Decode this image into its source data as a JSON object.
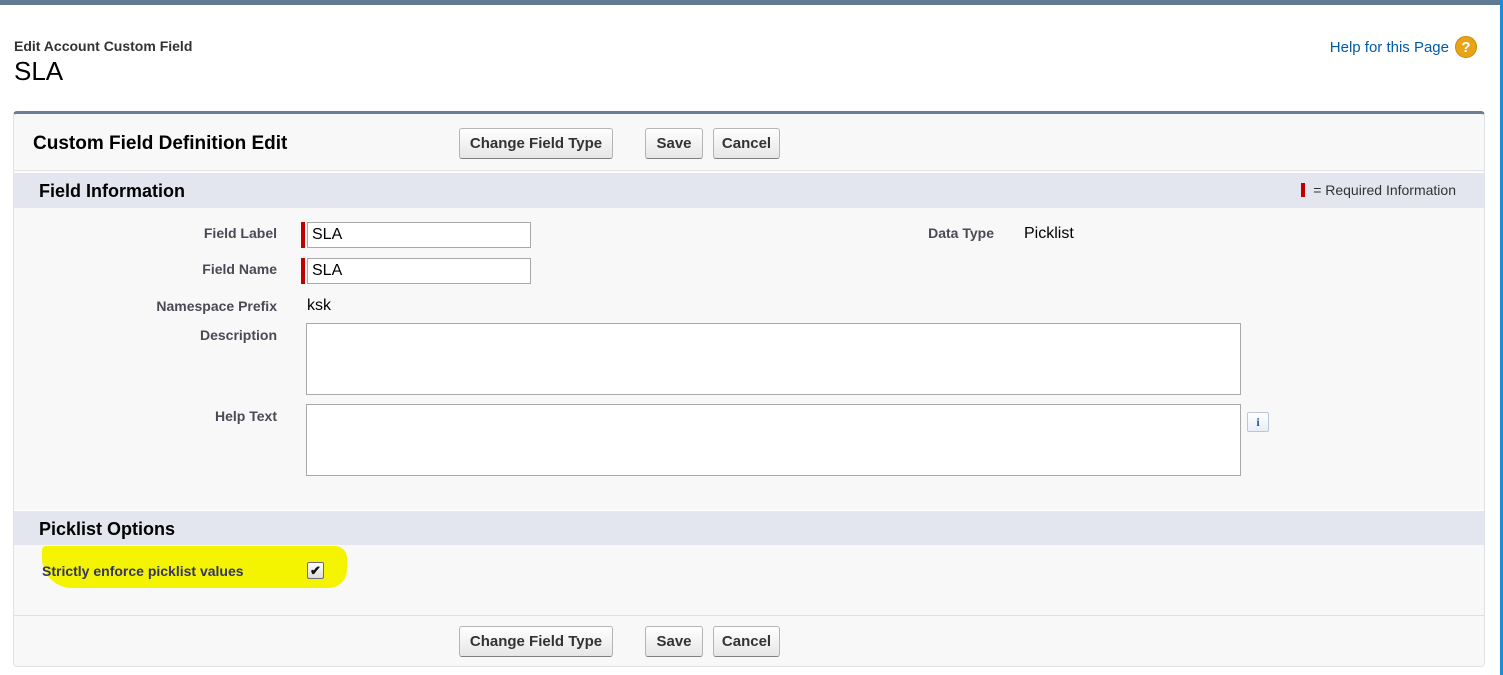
{
  "header": {
    "page_type": "Edit Account Custom Field",
    "title": "SLA",
    "help_link": "Help for this Page",
    "help_icon": "question-icon"
  },
  "panel": {
    "title": "Custom Field Definition Edit",
    "buttons": {
      "change_field_type": "Change Field Type",
      "save": "Save",
      "cancel": "Cancel"
    }
  },
  "field_information": {
    "section_title": "Field Information",
    "required_legend": "= Required Information",
    "field_label": {
      "label": "Field Label",
      "value": "SLA"
    },
    "field_name": {
      "label": "Field Name",
      "value": "SLA"
    },
    "namespace_prefix": {
      "label": "Namespace Prefix",
      "value": "ksk"
    },
    "description": {
      "label": "Description",
      "value": ""
    },
    "help_text": {
      "label": "Help Text",
      "value": ""
    },
    "data_type": {
      "label": "Data Type",
      "value": "Picklist"
    }
  },
  "picklist_options": {
    "section_title": "Picklist Options",
    "strictly_enforce": {
      "label": "Strictly enforce picklist values",
      "checked": true,
      "check_glyph": "✔"
    }
  },
  "colors": {
    "required": "#c00000",
    "link": "#015ba7",
    "section_bg": "#e3e6ee",
    "highlight": "#f4f400"
  }
}
